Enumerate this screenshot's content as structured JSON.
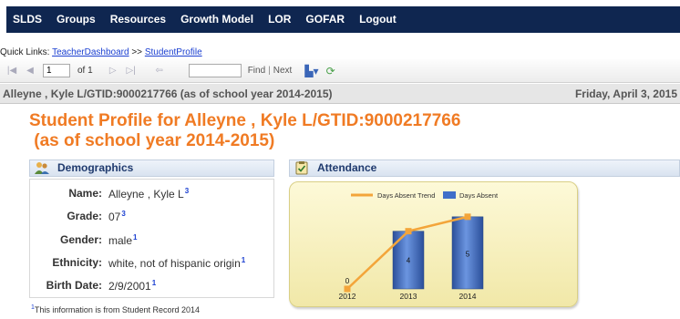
{
  "nav": {
    "items": [
      "SLDS",
      "Groups",
      "Resources",
      "Growth Model",
      "LOR",
      "GOFAR",
      "Logout"
    ]
  },
  "quicklinks": {
    "prefix": "Quick Links: ",
    "link1": "TeacherDashboard",
    "sep": " >> ",
    "link2": "StudentProfile"
  },
  "toolbar": {
    "page_value": "1",
    "of_text": "of 1",
    "find_value": "",
    "find_label": "Find",
    "sep": "|",
    "next_label": "Next"
  },
  "report_header": {
    "left": "Alleyne , Kyle L/GTID:9000217766 (as of school year 2014-2015)",
    "right": "Friday, April 3, 2015"
  },
  "title": {
    "line1": "Student Profile for Alleyne , Kyle L/GTID:9000217766",
    "line2": " (as of school year 2014-2015)"
  },
  "demographics": {
    "header": "Demographics",
    "rows": [
      {
        "label": "Name:",
        "value": "Alleyne , Kyle L",
        "sup": "3"
      },
      {
        "label": "Grade:",
        "value": "07",
        "sup": "3"
      },
      {
        "label": "Gender:",
        "value": "male",
        "sup": "1"
      },
      {
        "label": "Ethnicity:",
        "value": "white, not of hispanic origin",
        "sup": "1"
      },
      {
        "label": "Birth Date:",
        "value": "2/9/2001",
        "sup": "1"
      }
    ],
    "footnote_sup": "1",
    "footnote": "This information is from Student Record 2014"
  },
  "attendance": {
    "header": "Attendance"
  },
  "chart_data": {
    "type": "bar",
    "categories": [
      "2012",
      "2013",
      "2014"
    ],
    "series": [
      {
        "name": "Days Absent",
        "values": [
          0,
          4,
          5
        ],
        "color": "#3f6fc9"
      },
      {
        "name": "Days Absent Trend",
        "values": [
          0,
          4,
          5
        ],
        "color": "#f3a53a"
      }
    ],
    "data_labels": [
      "0",
      "4",
      "5"
    ],
    "legend": "top",
    "ylim": [
      0,
      6
    ]
  },
  "colors": {
    "nav_bg": "#0f2650",
    "title": "#f07b24",
    "section_text": "#1f3a6e",
    "link": "#1a3fd1"
  },
  "icons": [
    "first-page-icon",
    "prev-page-icon",
    "next-page-icon",
    "last-page-icon",
    "back-icon",
    "export-icon",
    "refresh-icon",
    "demographics-people-icon",
    "attendance-clipboard-icon"
  ]
}
